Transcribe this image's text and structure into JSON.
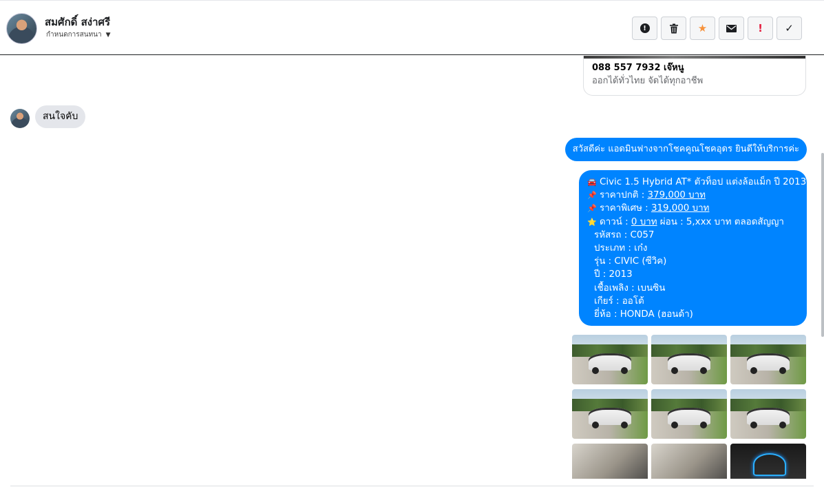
{
  "header": {
    "contact_name": "สมศักดิ์ สง่าศรี",
    "contact_sub": "กำหนดการสนทนา",
    "buttons": [
      {
        "name": "report-alert-button",
        "icon": "alert-circle-icon"
      },
      {
        "name": "delete-button",
        "icon": "trash-icon"
      },
      {
        "name": "star-button",
        "icon": "star-icon"
      },
      {
        "name": "mail-button",
        "icon": "envelope-icon"
      },
      {
        "name": "important-button",
        "icon": "exclamation-icon"
      },
      {
        "name": "done-button",
        "icon": "check-icon"
      }
    ]
  },
  "chat": {
    "shared_card": {
      "title": "088 557 7932 เจ๊หนู",
      "subtitle": "ออกได้ทั่วไทย จัดได้ทุกอาชีพ"
    },
    "incoming_message": "สนใจคับ",
    "outgoing_greeting": "สวัสดีค่ะ แอดมินฟางจากโชคคูณโชคอุดร ยินดีให้บริการค่ะ",
    "listing": {
      "title_line": "Civic 1.5 Hybrid AT* ตัวท็อป แต่งล้อแม็ก ปี 2013",
      "normal_price_label": "ราคาปกติ : ",
      "normal_price": "379,000 บาท",
      "special_price_label": "ราคาพิเศษ : ",
      "special_price": "319,000 บาท",
      "down_label": "ดาวน์ : ",
      "down_value": "0 บาท",
      "installment": " ผ่อน : 5,xxx บาท ตลอดสัญญา",
      "details": [
        "รหัสรถ : C057",
        "ประเภท : เก๋ง",
        "รุ่น : CIVIC (ซีวิค)",
        "ปี : 2013",
        "เชื้อเพลิง : เบนซิน",
        "เกียร์ : ออโต้",
        "ยี่ห้อ : HONDA (ฮอนด้า)"
      ]
    },
    "photos": [
      "car-front-left",
      "car-front",
      "car-rear",
      "car-rear-left",
      "car-front-3q",
      "car-side-right",
      "car-interior-door",
      "car-interior-seats",
      "car-dashboard"
    ]
  },
  "colors": {
    "outgoing_bubble": "#0084ff",
    "incoming_bubble": "#e4e6eb",
    "star_accent": "#f7923b",
    "alert_red": "#e41e3f"
  }
}
